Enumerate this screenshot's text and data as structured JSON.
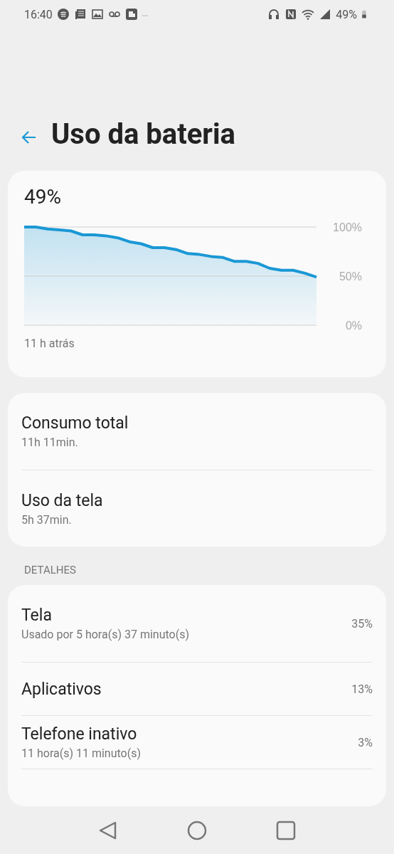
{
  "status_bar": {
    "time": "16:40",
    "battery": "49%"
  },
  "header": {
    "title": "Uso da bateria"
  },
  "battery_card": {
    "level_text": "49%",
    "since": "11 h atrás",
    "chart_data": {
      "type": "area",
      "categories": [
        null,
        null,
        null,
        null,
        null,
        null,
        null,
        null,
        null,
        null,
        null,
        null,
        null,
        null,
        null,
        null,
        null,
        null,
        null,
        null,
        null,
        null,
        null,
        null,
        null,
        null
      ],
      "series": [
        {
          "color": "#1a98d5",
          "values": [
            100,
            100,
            98,
            97,
            96,
            92,
            92,
            91,
            89,
            85,
            83,
            79,
            79,
            77,
            73,
            72,
            70,
            69,
            65,
            65,
            63,
            58,
            56,
            56,
            53,
            49
          ]
        }
      ],
      "ylim": [
        0,
        100
      ],
      "yticks": [
        {
          "value": 0,
          "label": "0%"
        },
        {
          "value": 50,
          "label": "50%"
        },
        {
          "value": 100,
          "label": "100%"
        }
      ]
    }
  },
  "summary": [
    {
      "title": "Consumo total",
      "subtitle": "11h 11min."
    },
    {
      "title": "Uso da tela",
      "subtitle": "5h 37min."
    }
  ],
  "details_header": "DETALHES",
  "details": [
    {
      "title": "Tela",
      "subtitle": "Usado por 5 hora(s) 37 minuto(s)",
      "percent": "35%"
    },
    {
      "title": "Aplicativos",
      "percent": "13%"
    },
    {
      "title": "Telefone inativo",
      "subtitle": "11 hora(s) 11 minuto(s)",
      "percent": "3%"
    }
  ]
}
